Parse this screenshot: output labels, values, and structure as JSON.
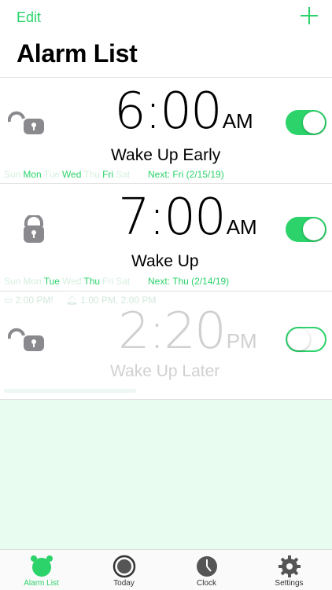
{
  "nav": {
    "edit_label": "Edit",
    "title": "Alarm List"
  },
  "alarms": [
    {
      "time": "6:00",
      "ampm": "AM",
      "label": "Wake Up Early",
      "days": [
        {
          "d": "Sun",
          "on": false
        },
        {
          "d": "Mon",
          "on": true
        },
        {
          "d": "Tue",
          "on": false
        },
        {
          "d": "Wed",
          "on": true
        },
        {
          "d": "Thu",
          "on": false
        },
        {
          "d": "Fri",
          "on": true
        },
        {
          "d": "Sat",
          "on": false
        }
      ],
      "next": "Next: Fri (2/15/19)",
      "enabled": true,
      "locked": false
    },
    {
      "time": "7:00",
      "ampm": "AM",
      "label": "Wake Up",
      "days": [
        {
          "d": "Sun",
          "on": false
        },
        {
          "d": "Mon",
          "on": false
        },
        {
          "d": "Tue",
          "on": true
        },
        {
          "d": "Wed",
          "on": false
        },
        {
          "d": "Thu",
          "on": true
        },
        {
          "d": "Fri",
          "on": false
        },
        {
          "d": "Sat",
          "on": false
        }
      ],
      "next": "Next: Thu (2/14/19)",
      "enabled": true,
      "locked": true
    },
    {
      "time": "2:20",
      "ampm": "PM",
      "label": "Wake Up Later",
      "meta_sleep": "2:00 PM!",
      "meta_bell": "1:00 PM, 2:00 PM",
      "enabled": false,
      "locked": false
    }
  ],
  "tabs": [
    {
      "label": "Alarm List",
      "icon": "alarm-clock-icon",
      "active": true
    },
    {
      "label": "Today",
      "icon": "today-icon",
      "active": false
    },
    {
      "label": "Clock",
      "icon": "clock-icon",
      "active": false
    },
    {
      "label": "Settings",
      "icon": "gear-icon",
      "active": false
    }
  ],
  "colors": {
    "accent": "#2bd36a",
    "muted_text": "#d6efdf",
    "empty_bg": "#e8fdef"
  }
}
